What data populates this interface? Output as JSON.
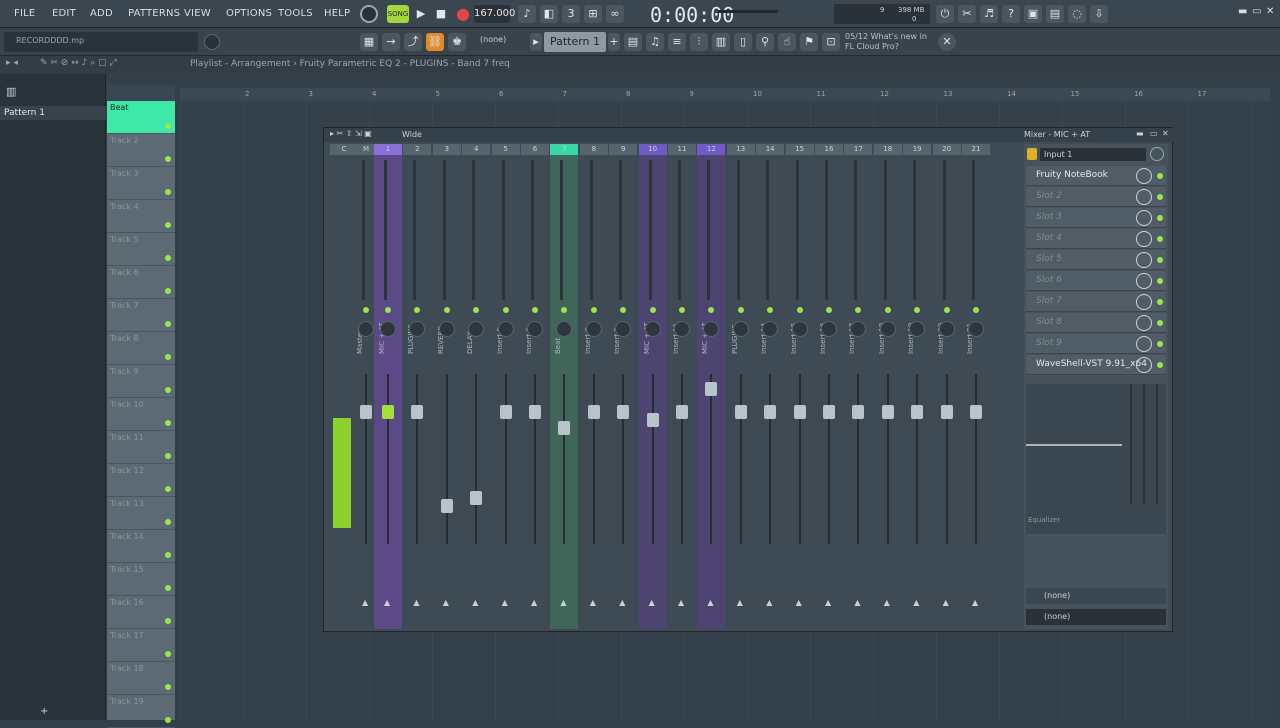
{
  "menu": [
    "FILE",
    "EDIT",
    "ADD",
    "PATTERNS",
    "VIEW",
    "OPTIONS",
    "TOOLS",
    "HELP"
  ],
  "transport": {
    "bpm": "167.000",
    "time": "0:00:00",
    "mode": "SONG",
    "cpu": "9",
    "mem": "398 MB",
    "poly": "0"
  },
  "hint": "RECORDDDD.mp",
  "pattern": "Pattern 1",
  "none_label": "(none)",
  "news": "05/12  What's new in FL Cloud Pro?",
  "breadcrumb": "Playlist - Arrangement  ›  Fruity Parametric EQ 2 - PLUGINS - Band 7 freq",
  "browser": {
    "pattern_item": "Pattern 1"
  },
  "playlist": {
    "tracks": [
      "Beat",
      "Track 2",
      "Track 3",
      "Track 4",
      "Track 5",
      "Track 6",
      "Track 7",
      "Track 8",
      "Track 9",
      "Track 10",
      "Track 11",
      "Track 12",
      "Track 13",
      "Track 14",
      "Track 15",
      "Track 16",
      "Track 17",
      "Track 18",
      "Track 19"
    ],
    "ruler": [
      "2",
      "3",
      "4",
      "5",
      "6",
      "7",
      "8",
      "9",
      "10",
      "11",
      "12",
      "13",
      "14",
      "15",
      "16",
      "17"
    ]
  },
  "mixer": {
    "title_left": "Wide",
    "title_right": "Mixer - MIC + AT",
    "strips": [
      {
        "num": "C",
        "name": "",
        "style": "plain",
        "fader": 0.0
      },
      {
        "num": "M",
        "name": "Master",
        "style": "plain",
        "fader": 0.8
      },
      {
        "num": "1",
        "name": "MIC + AT",
        "style": "sel",
        "fader": 0.8
      },
      {
        "num": "2",
        "name": "PLUGINS",
        "style": "plain",
        "fader": 0.8
      },
      {
        "num": "3",
        "name": "REVERB",
        "style": "plain",
        "fader": 0.2
      },
      {
        "num": "4",
        "name": "DELAY",
        "style": "plain",
        "fader": 0.25
      },
      {
        "num": "5",
        "name": "Insert 5",
        "style": "plain",
        "fader": 0.8
      },
      {
        "num": "6",
        "name": "Insert 6",
        "style": "plain",
        "fader": 0.8
      },
      {
        "num": "7",
        "name": "Beat",
        "style": "green",
        "fader": 0.7
      },
      {
        "num": "8",
        "name": "Insert 8",
        "style": "plain",
        "fader": 0.8
      },
      {
        "num": "9",
        "name": "Insert 9",
        "style": "plain",
        "fader": 0.8
      },
      {
        "num": "10",
        "name": "MIC + AT",
        "style": "purple",
        "fader": 0.75
      },
      {
        "num": "11",
        "name": "Insert 11",
        "style": "plain",
        "fader": 0.8
      },
      {
        "num": "12",
        "name": "MIC + AT",
        "style": "purple",
        "fader": 0.95
      },
      {
        "num": "13",
        "name": "PLUGINS",
        "style": "plain",
        "fader": 0.8
      },
      {
        "num": "14",
        "name": "Insert 14",
        "style": "plain",
        "fader": 0.8
      },
      {
        "num": "15",
        "name": "Insert 15",
        "style": "plain",
        "fader": 0.8
      },
      {
        "num": "16",
        "name": "Insert 16",
        "style": "plain",
        "fader": 0.8
      },
      {
        "num": "17",
        "name": "Insert 17",
        "style": "plain",
        "fader": 0.8
      },
      {
        "num": "18",
        "name": "Insert 18",
        "style": "plain",
        "fader": 0.8
      },
      {
        "num": "19",
        "name": "Insert 19",
        "style": "plain",
        "fader": 0.8
      },
      {
        "num": "20",
        "name": "Insert 20",
        "style": "plain",
        "fader": 0.8
      },
      {
        "num": "21",
        "name": "Insert 21",
        "style": "plain",
        "fader": 0.8
      }
    ],
    "insert": {
      "input": "Input 1",
      "slots": [
        "Fruity NoteBook",
        "Slot 2",
        "Slot 3",
        "Slot 4",
        "Slot 5",
        "Slot 6",
        "Slot 7",
        "Slot 8",
        "Slot 9",
        "WaveShell-VST 9.91_x64"
      ],
      "eq_label": "Equalizer",
      "out1": "(none)",
      "out2": "(none)"
    }
  }
}
